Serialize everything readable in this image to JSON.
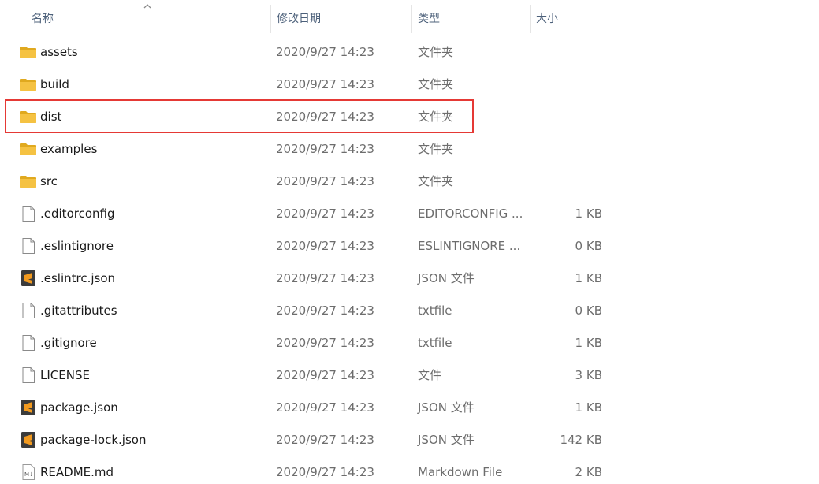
{
  "columns": {
    "name": "名称",
    "date": "修改日期",
    "type": "类型",
    "size": "大小"
  },
  "highlight_row": "dist",
  "colors": {
    "folder": "#f5c242",
    "folder_dark": "#e0a91f",
    "sublime": "#f29a1f",
    "highlight": "#e53935"
  },
  "files": [
    {
      "name": "assets",
      "date": "2020/9/27 14:23",
      "type": "文件夹",
      "size": "",
      "icon": "folder-icon"
    },
    {
      "name": "build",
      "date": "2020/9/27 14:23",
      "type": "文件夹",
      "size": "",
      "icon": "folder-icon"
    },
    {
      "name": "dist",
      "date": "2020/9/27 14:23",
      "type": "文件夹",
      "size": "",
      "icon": "folder-icon"
    },
    {
      "name": "examples",
      "date": "2020/9/27 14:23",
      "type": "文件夹",
      "size": "",
      "icon": "folder-icon"
    },
    {
      "name": "src",
      "date": "2020/9/27 14:23",
      "type": "文件夹",
      "size": "",
      "icon": "folder-icon"
    },
    {
      "name": ".editorconfig",
      "date": "2020/9/27 14:23",
      "type": "EDITORCONFIG ...",
      "size": "1 KB",
      "icon": "file-icon"
    },
    {
      "name": ".eslintignore",
      "date": "2020/9/27 14:23",
      "type": "ESLINTIGNORE ...",
      "size": "0 KB",
      "icon": "file-icon"
    },
    {
      "name": ".eslintrc.json",
      "date": "2020/9/27 14:23",
      "type": "JSON 文件",
      "size": "1 KB",
      "icon": "sublime-file-icon"
    },
    {
      "name": ".gitattributes",
      "date": "2020/9/27 14:23",
      "type": "txtfile",
      "size": "0 KB",
      "icon": "file-icon"
    },
    {
      "name": ".gitignore",
      "date": "2020/9/27 14:23",
      "type": "txtfile",
      "size": "1 KB",
      "icon": "file-icon"
    },
    {
      "name": "LICENSE",
      "date": "2020/9/27 14:23",
      "type": "文件",
      "size": "3 KB",
      "icon": "file-icon"
    },
    {
      "name": "package.json",
      "date": "2020/9/27 14:23",
      "type": "JSON 文件",
      "size": "1 KB",
      "icon": "sublime-file-icon"
    },
    {
      "name": "package-lock.json",
      "date": "2020/9/27 14:23",
      "type": "JSON 文件",
      "size": "142 KB",
      "icon": "sublime-file-icon"
    },
    {
      "name": "README.md",
      "date": "2020/9/27 14:23",
      "type": "Markdown File",
      "size": "2 KB",
      "icon": "markdown-file-icon"
    }
  ]
}
